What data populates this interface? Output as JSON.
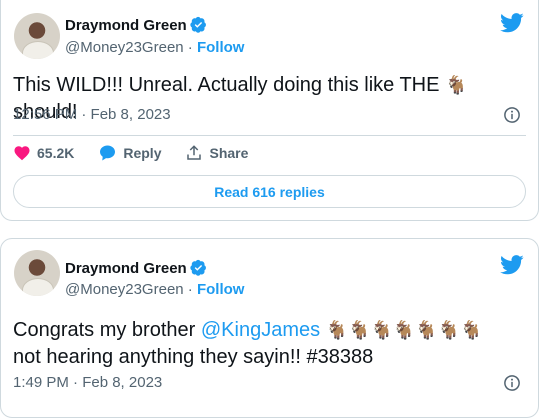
{
  "tweets": [
    {
      "author_name": "Draymond Green",
      "handle": "@Money23Green",
      "separator": "·",
      "follow_label": "Follow",
      "text_before": "This WILD!!! Unreal. Actually doing this like THE ",
      "text_emoji": "🐐",
      "text_after": "should!",
      "timestamp": "12:56 PM · Feb 8, 2023",
      "likes": "65.2K",
      "reply_label": "Reply",
      "share_label": "Share",
      "read_replies_label": "Read 616 replies"
    },
    {
      "author_name": "Draymond Green",
      "handle": "@Money23Green",
      "separator": "·",
      "follow_label": "Follow",
      "text_before": "Congrats my brother ",
      "mention": "@KingJames",
      "emojis": "🐐🐐🐐🐐🐐🐐🐐",
      "line2": "not hearing anything they sayin!! #38388",
      "timestamp": "1:49 PM · Feb 8, 2023"
    }
  ],
  "colors": {
    "accent": "#1d9bf0",
    "like": "#f91880",
    "muted": "#536471",
    "border": "#cfd9de"
  },
  "icons": [
    "verified-badge-icon",
    "twitter-bird-icon",
    "info-icon",
    "heart-icon",
    "reply-bubble-icon",
    "share-icon"
  ]
}
